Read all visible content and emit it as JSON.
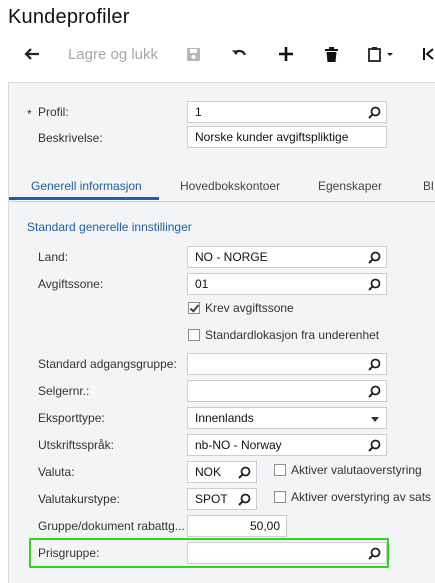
{
  "page": {
    "title": "Kundeprofiler"
  },
  "toolbar": {
    "back_icon": "arrow-left-icon",
    "save_close_label": "Lagre og lukk",
    "save_icon": "save-icon",
    "undo_icon": "undo-icon",
    "add_icon": "plus-icon",
    "delete_icon": "trash-icon",
    "copy_paste_icon": "clipboard-icon",
    "first_icon": "first-record-icon"
  },
  "header": {
    "profile_label": "Profil:",
    "profile_required": "*",
    "profile_value": "1",
    "description_label": "Beskrivelse:",
    "description_value": "Norske kunder avgiftspliktige"
  },
  "tabs": [
    {
      "label": "Generell informasjon"
    },
    {
      "label": "Hovedbokskontoer"
    },
    {
      "label": "Egenskaper"
    },
    {
      "label": "Bl"
    }
  ],
  "form": {
    "section_title": "Standard generelle innstillinger",
    "country_label": "Land:",
    "country_value": "NO - NORGE",
    "tax_zone_label": "Avgiftssone:",
    "tax_zone_value": "01",
    "require_tax_zone_label": "Krev avgiftssone",
    "require_tax_zone_checked": true,
    "default_location_label": "Standardlokasjon fra underenhet",
    "default_location_checked": false,
    "access_group_label": "Standard adgangsgruppe:",
    "access_group_value": "",
    "seller_label": "Selgernr.:",
    "seller_value": "",
    "export_type_label": "Eksporttype:",
    "export_type_value": "Innenlands",
    "print_language_label": "Utskriftsspråk:",
    "print_language_value": "nb-NO - Norway",
    "currency_label": "Valuta:",
    "currency_value": "NOK",
    "currency_override_label": "Aktiver valutaoverstyring",
    "rate_type_label": "Valutakurstype:",
    "rate_type_value": "SPOT",
    "rate_override_label": "Aktiver overstyring av sats",
    "group_discount_label": "Gruppe/dokument rabattg...",
    "group_discount_value": "50,00",
    "price_group_label": "Prisgruppe:",
    "price_group_value": ""
  },
  "colors": {
    "accent": "#1f5fa7",
    "highlight": "#35d11f",
    "panel": "#f3f4f6"
  }
}
